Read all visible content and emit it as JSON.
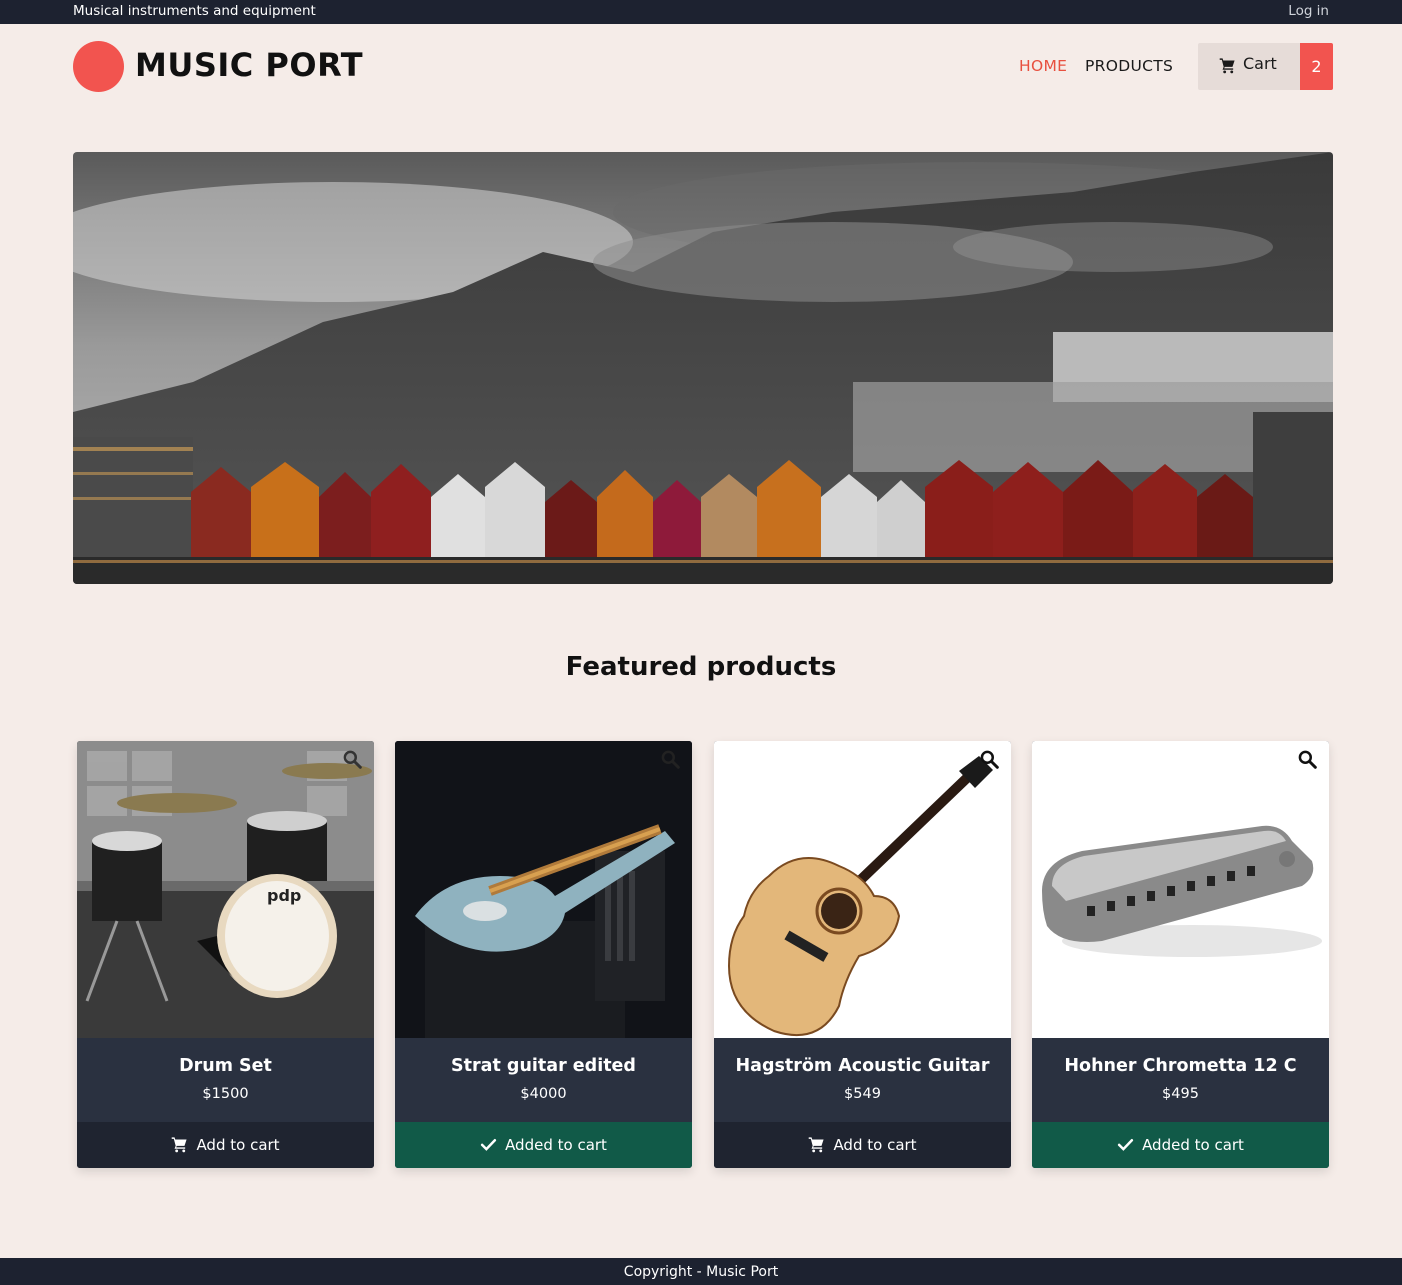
{
  "topbar": {
    "tagline": "Musical instruments and equipment",
    "login": "Log in"
  },
  "header": {
    "brand": "MUSIC PORT",
    "nav": [
      {
        "label": "HOME",
        "active": true
      },
      {
        "label": "PRODUCTS",
        "active": false
      }
    ],
    "cart": {
      "label": "Cart",
      "count": "2",
      "icon": "cart-icon"
    }
  },
  "hero": {
    "image": "mountain-town-waterfront-photo"
  },
  "section": {
    "title": "Featured products"
  },
  "products": [
    {
      "name": "Drum Set",
      "price": "$1500",
      "action": "Add to cart",
      "state": "add",
      "image": "drum-set-photo"
    },
    {
      "name": "Strat guitar edited",
      "price": "$4000",
      "action": "Added to cart",
      "state": "added",
      "image": "electric-guitar-photo"
    },
    {
      "name": "Hagström Acoustic Guitar",
      "price": "$549",
      "action": "Add to cart",
      "state": "add",
      "image": "acoustic-guitar-photo"
    },
    {
      "name": "Hohner Chrometta 12 C",
      "price": "$495",
      "action": "Added to cart",
      "state": "added",
      "image": "harmonica-photo"
    }
  ],
  "footer": {
    "copyright": "Copyright - Music Port"
  },
  "colors": {
    "accent": "#f2544f",
    "dark": "#1d2230",
    "card": "#2a3140",
    "added": "#115a48",
    "background": "#f5ece8"
  }
}
